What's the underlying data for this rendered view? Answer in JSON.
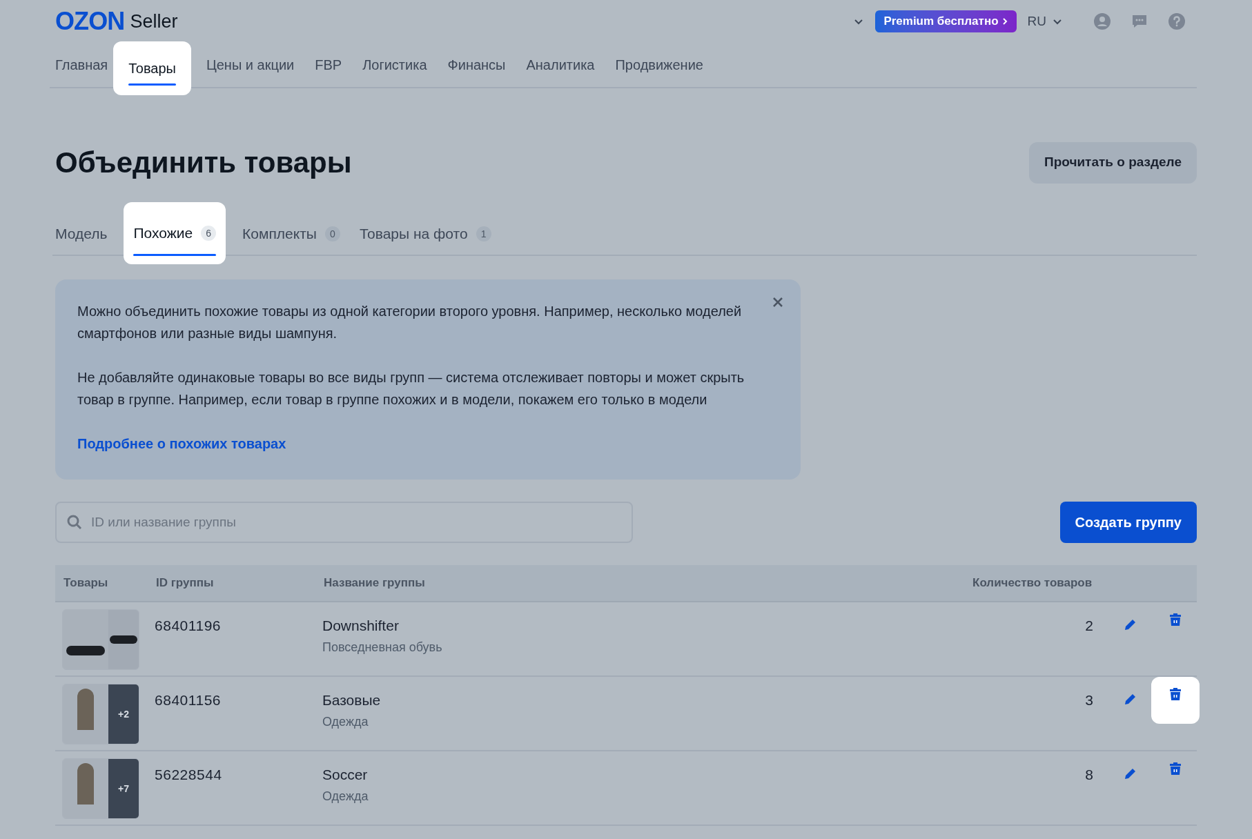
{
  "header": {
    "logo": "OZON",
    "product": "Seller",
    "premium": "Premium бесплатно",
    "language": "RU"
  },
  "nav": [
    {
      "label": "Главная",
      "selected": false,
      "highlighted": false
    },
    {
      "label": "Товары",
      "selected": true,
      "highlighted": true
    },
    {
      "label": "Цены и акции",
      "selected": false,
      "highlighted": false
    },
    {
      "label": "FBP",
      "selected": false,
      "highlighted": false
    },
    {
      "label": "Логистика",
      "selected": false,
      "highlighted": false
    },
    {
      "label": "Финансы",
      "selected": false,
      "highlighted": false
    },
    {
      "label": "Аналитика",
      "selected": false,
      "highlighted": false
    },
    {
      "label": "Продвижение",
      "selected": false,
      "highlighted": false
    }
  ],
  "page": {
    "title": "Объединить товары",
    "read_button": "Прочитать о разделе"
  },
  "tabs": [
    {
      "label": "Модель",
      "selected": false,
      "highlighted": false
    },
    {
      "label": "Похожие",
      "count": "6",
      "selected": true,
      "highlighted": true
    },
    {
      "label": "Комплекты",
      "count": "0",
      "selected": false,
      "highlighted": false
    },
    {
      "label": "Товары на фото",
      "count": "1",
      "selected": false,
      "highlighted": false
    }
  ],
  "info": {
    "paragraphs": [
      "Можно объединить похожие товары из одной категории второго уровня. Например, несколько моделей смартфонов или разные виды шампуня.",
      "Не добавляйте одинаковые товары во все виды групп — система отслеживает повторы и может скрыть товар в группе. Например, если товар в группе похожих и в модели, покажем его только в модели"
    ],
    "link": "Подробнее о похожих товарах"
  },
  "search": {
    "placeholder": "ID или название группы"
  },
  "create_button": "Создать группу",
  "table": {
    "columns": [
      "Товары",
      "ID группы",
      "Название группы",
      "Количество товаров"
    ],
    "rows": [
      {
        "kind": "shoes",
        "id": "68401196",
        "name": "Downshifter",
        "category": "Повседневная обувь",
        "count": "2",
        "delete_highlighted": false
      },
      {
        "kind": "clothes",
        "more": "+2",
        "id": "68401156",
        "name": "Базовые",
        "category": "Одежда",
        "count": "3",
        "delete_highlighted": true
      },
      {
        "kind": "clothes",
        "more": "+7",
        "id": "56228544",
        "name": "Soccer",
        "category": "Одежда",
        "count": "8",
        "delete_highlighted": false
      }
    ]
  }
}
